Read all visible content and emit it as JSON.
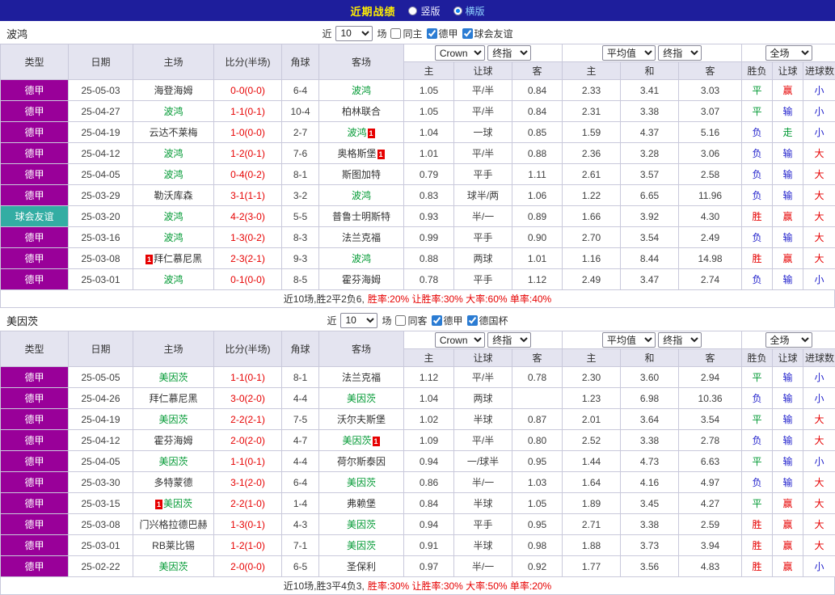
{
  "topbar": {
    "title": "近期战绩",
    "layout_options": [
      {
        "label": "竖版",
        "selected": false
      },
      {
        "label": "横版",
        "selected": true
      }
    ]
  },
  "columns": [
    "类型",
    "日期",
    "主场",
    "比分(半场)",
    "角球",
    "客场",
    "主",
    "让球",
    "客",
    "主",
    "和",
    "客",
    "胜负",
    "让球",
    "进球数"
  ],
  "controls": {
    "near_prefix": "近",
    "near_count": "10",
    "near_suffix": "场",
    "odds_source": "Crown",
    "odds_stage": "终指",
    "avg_label": "平均值",
    "avg_stage": "终指",
    "scope": "全场"
  },
  "league_colors": {
    "德甲": "#990099",
    "球会友谊": "#33ADA3",
    "德国杯": "#33ADA3"
  },
  "result_colors": {
    "胜": "#E60000",
    "平": "#009933",
    "负": "#2222CC",
    "赢": "#E60000",
    "输": "#2222CC",
    "走": "#009933",
    "大": "#E60000",
    "小": "#2222CC"
  },
  "sections": [
    {
      "team": "波鸿",
      "filters": [
        {
          "label": "同主",
          "checked": false
        },
        {
          "label": "德甲",
          "checked": true
        },
        {
          "label": "球会友谊",
          "checked": true
        }
      ],
      "rows": [
        {
          "league": "德甲",
          "date": "25-05-03",
          "home": {
            "name": "海登海姆"
          },
          "score": "0-0(0-0)",
          "corner": "6-4",
          "away": {
            "name": "波鸿",
            "focus": true
          },
          "odds": [
            "1.05",
            "平/半",
            "0.84"
          ],
          "avg": [
            "2.33",
            "3.41",
            "3.03"
          ],
          "wdl": "平",
          "let": "赢",
          "goal": "小"
        },
        {
          "league": "德甲",
          "date": "25-04-27",
          "home": {
            "name": "波鸿",
            "focus": true
          },
          "score": "1-1(0-1)",
          "corner": "10-4",
          "away": {
            "name": "柏林联合"
          },
          "odds": [
            "1.05",
            "平/半",
            "0.84"
          ],
          "avg": [
            "2.31",
            "3.38",
            "3.07"
          ],
          "wdl": "平",
          "let": "输",
          "goal": "小"
        },
        {
          "league": "德甲",
          "date": "25-04-19",
          "home": {
            "name": "云达不莱梅"
          },
          "score": "1-0(0-0)",
          "corner": "2-7",
          "away": {
            "name": "波鸿",
            "focus": true,
            "badge": "1",
            "badgePos": "after"
          },
          "odds": [
            "1.04",
            "一球",
            "0.85"
          ],
          "avg": [
            "1.59",
            "4.37",
            "5.16"
          ],
          "wdl": "负",
          "let": "走",
          "goal": "小"
        },
        {
          "league": "德甲",
          "date": "25-04-12",
          "home": {
            "name": "波鸿",
            "focus": true
          },
          "score": "1-2(0-1)",
          "corner": "7-6",
          "away": {
            "name": "奥格斯堡",
            "badge": "1",
            "badgePos": "after"
          },
          "odds": [
            "1.01",
            "平/半",
            "0.88"
          ],
          "avg": [
            "2.36",
            "3.28",
            "3.06"
          ],
          "wdl": "负",
          "let": "输",
          "goal": "大"
        },
        {
          "league": "德甲",
          "date": "25-04-05",
          "home": {
            "name": "波鸿",
            "focus": true
          },
          "score": "0-4(0-2)",
          "corner": "8-1",
          "away": {
            "name": "斯图加特"
          },
          "odds": [
            "0.79",
            "平手",
            "1.11"
          ],
          "avg": [
            "2.61",
            "3.57",
            "2.58"
          ],
          "wdl": "负",
          "let": "输",
          "goal": "大"
        },
        {
          "league": "德甲",
          "date": "25-03-29",
          "home": {
            "name": "勒沃库森"
          },
          "score": "3-1(1-1)",
          "corner": "3-2",
          "away": {
            "name": "波鸿",
            "focus": true
          },
          "odds": [
            "0.83",
            "球半/两",
            "1.06"
          ],
          "avg": [
            "1.22",
            "6.65",
            "11.96"
          ],
          "wdl": "负",
          "let": "输",
          "goal": "大"
        },
        {
          "league": "球会友谊",
          "date": "25-03-20",
          "home": {
            "name": "波鸿",
            "focus": true
          },
          "score": "4-2(3-0)",
          "corner": "5-5",
          "away": {
            "name": "普鲁士明斯特"
          },
          "odds": [
            "0.93",
            "半/一",
            "0.89"
          ],
          "avg": [
            "1.66",
            "3.92",
            "4.30"
          ],
          "wdl": "胜",
          "let": "赢",
          "goal": "大"
        },
        {
          "league": "德甲",
          "date": "25-03-16",
          "home": {
            "name": "波鸿",
            "focus": true
          },
          "score": "1-3(0-2)",
          "corner": "8-3",
          "away": {
            "name": "法兰克福"
          },
          "odds": [
            "0.99",
            "平手",
            "0.90"
          ],
          "avg": [
            "2.70",
            "3.54",
            "2.49"
          ],
          "wdl": "负",
          "let": "输",
          "goal": "大"
        },
        {
          "league": "德甲",
          "date": "25-03-08",
          "home": {
            "name": "拜仁慕尼黑",
            "badge": "1",
            "badgePos": "before"
          },
          "score": "2-3(2-1)",
          "corner": "9-3",
          "away": {
            "name": "波鸿",
            "focus": true
          },
          "odds": [
            "0.88",
            "两球",
            "1.01"
          ],
          "avg": [
            "1.16",
            "8.44",
            "14.98"
          ],
          "wdl": "胜",
          "let": "赢",
          "goal": "大"
        },
        {
          "league": "德甲",
          "date": "25-03-01",
          "home": {
            "name": "波鸿",
            "focus": true
          },
          "score": "0-1(0-0)",
          "corner": "8-5",
          "away": {
            "name": "霍芬海姆"
          },
          "odds": [
            "0.78",
            "平手",
            "1.12"
          ],
          "avg": [
            "2.49",
            "3.47",
            "2.74"
          ],
          "wdl": "负",
          "let": "输",
          "goal": "小"
        }
      ],
      "summary_prefix": "近10场,胜2平2负6,",
      "summary_stats": "胜率:20% 让胜率:30% 大率:60% 单率:40%"
    },
    {
      "team": "美因茨",
      "filters": [
        {
          "label": "同客",
          "checked": false
        },
        {
          "label": "德甲",
          "checked": true
        },
        {
          "label": "德国杯",
          "checked": true
        }
      ],
      "rows": [
        {
          "league": "德甲",
          "date": "25-05-05",
          "home": {
            "name": "美因茨",
            "focus": true
          },
          "score": "1-1(0-1)",
          "corner": "8-1",
          "away": {
            "name": "法兰克福"
          },
          "odds": [
            "1.12",
            "平/半",
            "0.78"
          ],
          "avg": [
            "2.30",
            "3.60",
            "2.94"
          ],
          "wdl": "平",
          "let": "输",
          "goal": "小"
        },
        {
          "league": "德甲",
          "date": "25-04-26",
          "home": {
            "name": "拜仁慕尼黑"
          },
          "score": "3-0(2-0)",
          "corner": "4-4",
          "away": {
            "name": "美因茨",
            "focus": true
          },
          "odds": [
            "1.04",
            "两球",
            ""
          ],
          "avg": [
            "1.23",
            "6.98",
            "10.36"
          ],
          "wdl": "负",
          "let": "输",
          "goal": "小"
        },
        {
          "league": "德甲",
          "date": "25-04-19",
          "home": {
            "name": "美因茨",
            "focus": true
          },
          "score": "2-2(2-1)",
          "corner": "7-5",
          "away": {
            "name": "沃尔夫斯堡"
          },
          "odds": [
            "1.02",
            "半球",
            "0.87"
          ],
          "avg": [
            "2.01",
            "3.64",
            "3.54"
          ],
          "wdl": "平",
          "let": "输",
          "goal": "大"
        },
        {
          "league": "德甲",
          "date": "25-04-12",
          "home": {
            "name": "霍芬海姆"
          },
          "score": "2-0(2-0)",
          "corner": "4-7",
          "away": {
            "name": "美因茨",
            "focus": true,
            "badge": "1",
            "badgePos": "after"
          },
          "odds": [
            "1.09",
            "平/半",
            "0.80"
          ],
          "avg": [
            "2.52",
            "3.38",
            "2.78"
          ],
          "wdl": "负",
          "let": "输",
          "goal": "大"
        },
        {
          "league": "德甲",
          "date": "25-04-05",
          "home": {
            "name": "美因茨",
            "focus": true
          },
          "score": "1-1(0-1)",
          "corner": "4-4",
          "away": {
            "name": "荷尔斯泰因"
          },
          "odds": [
            "0.94",
            "一/球半",
            "0.95"
          ],
          "avg": [
            "1.44",
            "4.73",
            "6.63"
          ],
          "wdl": "平",
          "let": "输",
          "goal": "小"
        },
        {
          "league": "德甲",
          "date": "25-03-30",
          "home": {
            "name": "多特蒙德"
          },
          "score": "3-1(2-0)",
          "corner": "6-4",
          "away": {
            "name": "美因茨",
            "focus": true
          },
          "odds": [
            "0.86",
            "半/一",
            "1.03"
          ],
          "avg": [
            "1.64",
            "4.16",
            "4.97"
          ],
          "wdl": "负",
          "let": "输",
          "goal": "大"
        },
        {
          "league": "德甲",
          "date": "25-03-15",
          "home": {
            "name": "美因茨",
            "focus": true,
            "badge": "1",
            "badgePos": "before"
          },
          "score": "2-2(1-0)",
          "corner": "1-4",
          "away": {
            "name": "弗赖堡"
          },
          "odds": [
            "0.84",
            "半球",
            "1.05"
          ],
          "avg": [
            "1.89",
            "3.45",
            "4.27"
          ],
          "wdl": "平",
          "let": "赢",
          "goal": "大"
        },
        {
          "league": "德甲",
          "date": "25-03-08",
          "home": {
            "name": "门兴格拉德巴赫"
          },
          "score": "1-3(0-1)",
          "corner": "4-3",
          "away": {
            "name": "美因茨",
            "focus": true
          },
          "odds": [
            "0.94",
            "平手",
            "0.95"
          ],
          "avg": [
            "2.71",
            "3.38",
            "2.59"
          ],
          "wdl": "胜",
          "let": "赢",
          "goal": "大"
        },
        {
          "league": "德甲",
          "date": "25-03-01",
          "home": {
            "name": "RB莱比锡"
          },
          "score": "1-2(1-0)",
          "corner": "7-1",
          "away": {
            "name": "美因茨",
            "focus": true
          },
          "odds": [
            "0.91",
            "半球",
            "0.98"
          ],
          "avg": [
            "1.88",
            "3.73",
            "3.94"
          ],
          "wdl": "胜",
          "let": "赢",
          "goal": "大"
        },
        {
          "league": "德甲",
          "date": "25-02-22",
          "home": {
            "name": "美因茨",
            "focus": true
          },
          "score": "2-0(0-0)",
          "corner": "6-5",
          "away": {
            "name": "圣保利"
          },
          "odds": [
            "0.97",
            "半/一",
            "0.92"
          ],
          "avg": [
            "1.77",
            "3.56",
            "4.83"
          ],
          "wdl": "胜",
          "let": "赢",
          "goal": "小"
        }
      ],
      "summary_prefix": "近10场,胜3平4负3,",
      "summary_stats": "胜率:30% 让胜率:30% 大率:50% 单率:20%"
    }
  ]
}
